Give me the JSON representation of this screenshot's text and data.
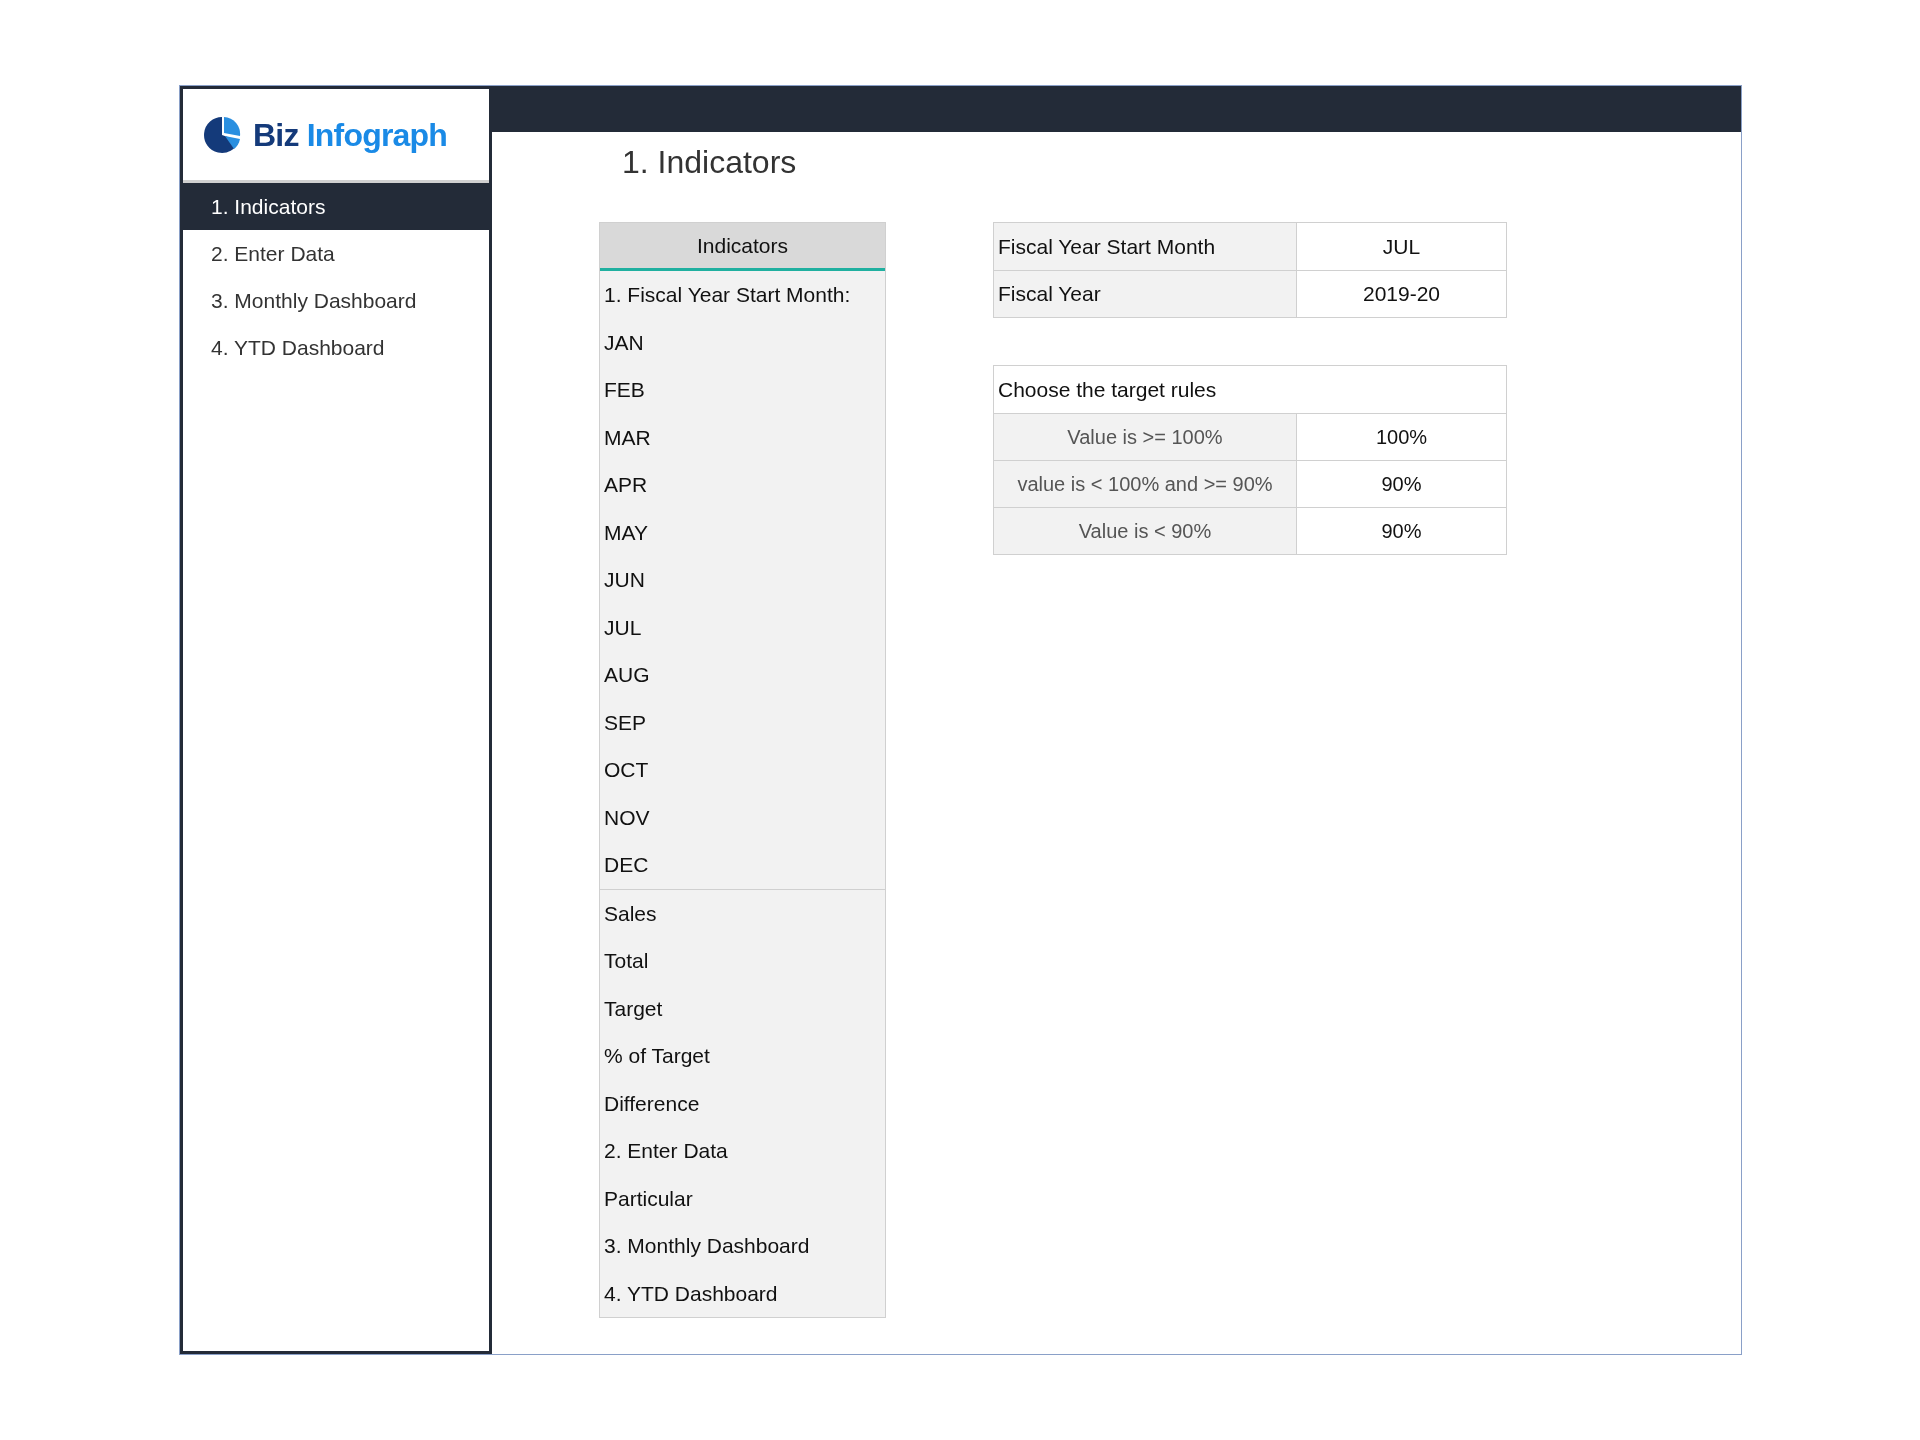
{
  "logo": {
    "first": "Biz",
    "second": "Infograph"
  },
  "nav": [
    {
      "label": "1. Indicators",
      "selected": true
    },
    {
      "label": "2. Enter Data",
      "selected": false
    },
    {
      "label": "3. Monthly Dashboard",
      "selected": false
    },
    {
      "label": "4. YTD Dashboard",
      "selected": false
    }
  ],
  "page_title": "1. Indicators",
  "indicators": {
    "header": "Indicators",
    "sections": [
      [
        "1. Fiscal Year Start Month:",
        "JAN",
        "FEB",
        "MAR",
        "APR",
        "MAY",
        "JUN",
        "JUL",
        "AUG",
        "SEP",
        "OCT",
        "NOV",
        "DEC"
      ],
      [
        "Sales",
        "Total",
        "Target",
        "% of Target",
        "Difference",
        "2. Enter Data",
        "Particular",
        "3. Monthly Dashboard",
        "4. YTD Dashboard"
      ]
    ]
  },
  "fiscal": [
    {
      "label": "Fiscal Year Start Month",
      "value": "JUL"
    },
    {
      "label": "Fiscal Year",
      "value": "2019-20"
    }
  ],
  "target_rules": {
    "title": "Choose the target rules",
    "rows": [
      {
        "label": "Value is >= 100%",
        "value": "100%"
      },
      {
        "label": "value is < 100% and >= 90%",
        "value": "90%"
      },
      {
        "label": "Value is < 90%",
        "value": "90%"
      }
    ]
  }
}
